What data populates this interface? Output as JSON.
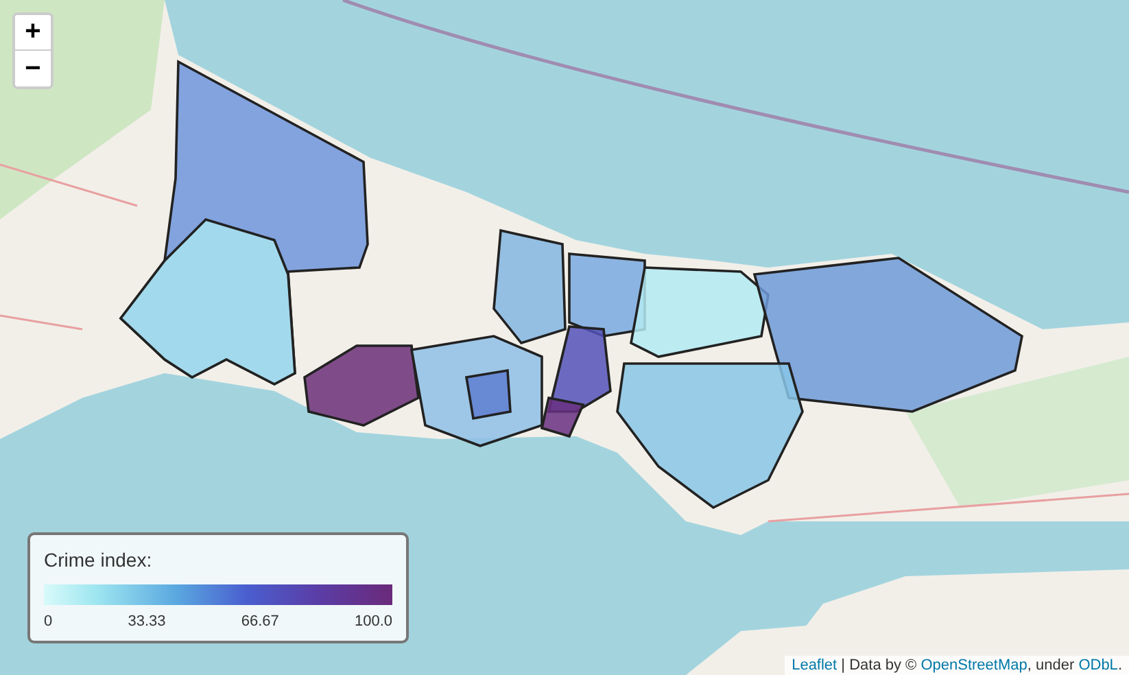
{
  "zoom_controls": [
    "+",
    "−"
  ],
  "legend": {
    "title": "Crime index:",
    "ticks": [
      "0",
      "33.33",
      "66.67",
      "100.0"
    ]
  },
  "attribution": [
    {
      "kind": "link",
      "text": "Leaflet"
    },
    {
      "kind": "text",
      "text": " | Data by © "
    },
    {
      "kind": "link",
      "text": "OpenStreetMap"
    },
    {
      "kind": "text",
      "text": ", under "
    },
    {
      "kind": "link",
      "text": "ODbL"
    },
    {
      "kind": "text",
      "text": "."
    }
  ]
}
